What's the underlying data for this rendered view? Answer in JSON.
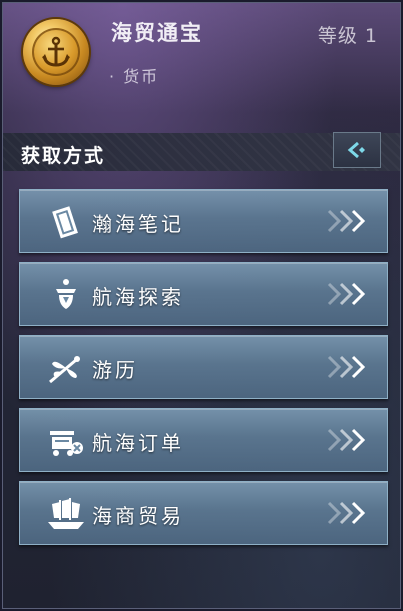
{
  "item": {
    "name": "海贸通宝",
    "type": "· 货币",
    "level": "等级 1",
    "icon": "anchor-coin-icon"
  },
  "section": {
    "title": "获取方式",
    "back_icon": "back-arrow-icon"
  },
  "options": [
    {
      "label": "瀚海笔记",
      "icon": "notebook-icon"
    },
    {
      "label": "航海探索",
      "icon": "explore-hand-icon"
    },
    {
      "label": "游历",
      "icon": "dragonfly-icon"
    },
    {
      "label": "航海订单",
      "icon": "order-cart-icon"
    },
    {
      "label": "海商贸易",
      "icon": "junk-ship-icon"
    }
  ],
  "colors": {
    "accent": "#8fb0c6",
    "gold": "#d99a2b"
  }
}
